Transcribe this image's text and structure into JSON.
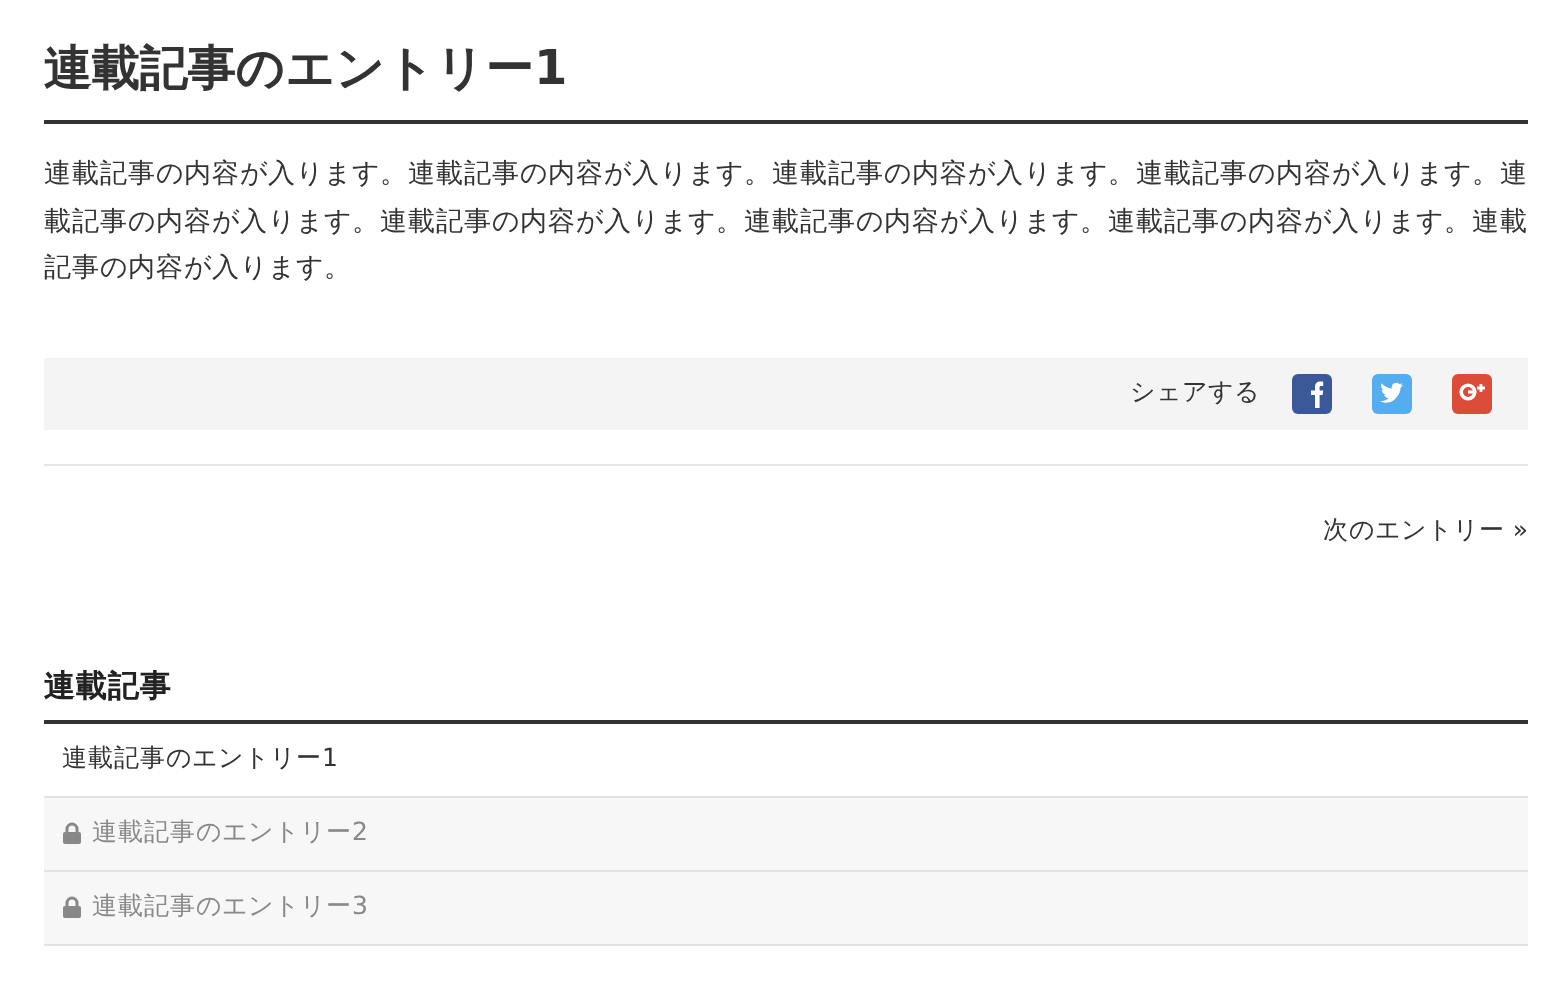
{
  "article": {
    "title": "連載記事のエントリー1",
    "body": "連載記事の内容が入ります。連載記事の内容が入ります。連載記事の内容が入ります。連載記事の内容が入ります。連載記事の内容が入ります。連載記事の内容が入ります。連載記事の内容が入ります。連載記事の内容が入ります。連載記事の内容が入ります。"
  },
  "share": {
    "label": "シェアする",
    "buttons": [
      {
        "kind": "facebook"
      },
      {
        "kind": "twitter"
      },
      {
        "kind": "googleplus"
      }
    ]
  },
  "next_link": "次のエントリー »",
  "series": {
    "heading": "連載記事",
    "entries": [
      {
        "title": "連載記事のエントリー1",
        "locked": false
      },
      {
        "title": "連載記事のエントリー2",
        "locked": true
      },
      {
        "title": "連載記事のエントリー3",
        "locked": true
      }
    ]
  }
}
